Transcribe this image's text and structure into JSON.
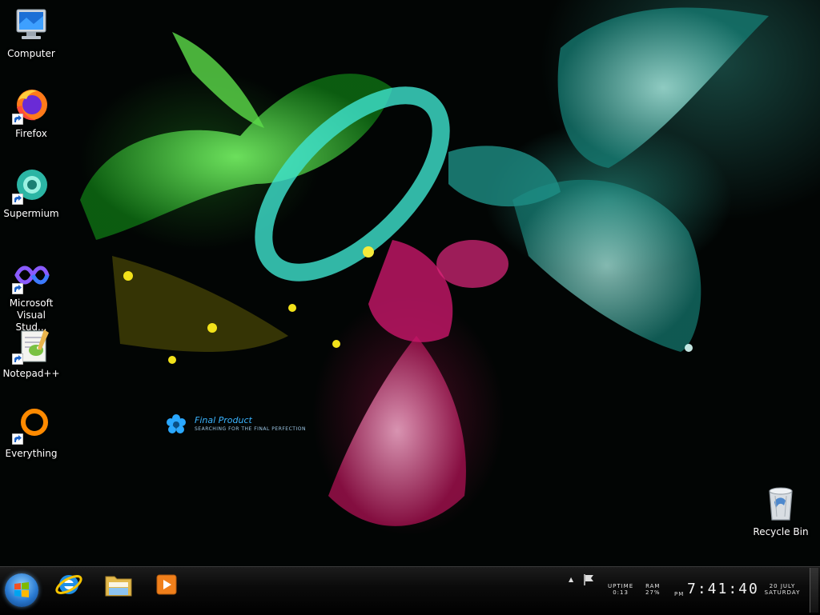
{
  "desktop": {
    "icons": [
      {
        "label": "Computer",
        "icon": "computer-icon"
      },
      {
        "label": "Firefox",
        "icon": "firefox-icon"
      },
      {
        "label": "Supermium",
        "icon": "supermium-icon"
      },
      {
        "label": "Microsoft\nVisual Stud...",
        "icon": "visual-studio-icon"
      },
      {
        "label": "Notepad++",
        "icon": "notepadplusplus-icon"
      },
      {
        "label": "Everything",
        "icon": "everything-icon"
      }
    ],
    "recycle_bin": {
      "label": "Recycle Bin",
      "icon": "recycle-bin-icon"
    },
    "wallpaper_logo": {
      "title": "Final Product",
      "subtitle": "SEARCHING FOR THE FINAL PERFECTION"
    }
  },
  "taskbar": {
    "start": {
      "icon": "windows-start-icon"
    },
    "pinned": [
      {
        "name": "Internet Explorer",
        "icon": "internet-explorer-icon"
      },
      {
        "name": "File Explorer",
        "icon": "folder-icon"
      },
      {
        "name": "Media Player",
        "icon": "media-player-icon"
      }
    ],
    "tray": {
      "expand_glyph": "▲",
      "uptime_label": "UPTIME",
      "uptime_value": "0:13",
      "ram_label": "RAM",
      "ram_value": "27%",
      "ampm": "PM",
      "time": "7:41:40",
      "date": "20 JULY",
      "weekday": "SATURDAY"
    }
  },
  "colors": {
    "accent_cyan": "#3ab4ff",
    "wallpaper_green": "#2ecc2e",
    "wallpaper_teal": "#2fd6c6",
    "wallpaper_pink": "#ff2f86",
    "wallpaper_yellow": "#f2e21a"
  }
}
